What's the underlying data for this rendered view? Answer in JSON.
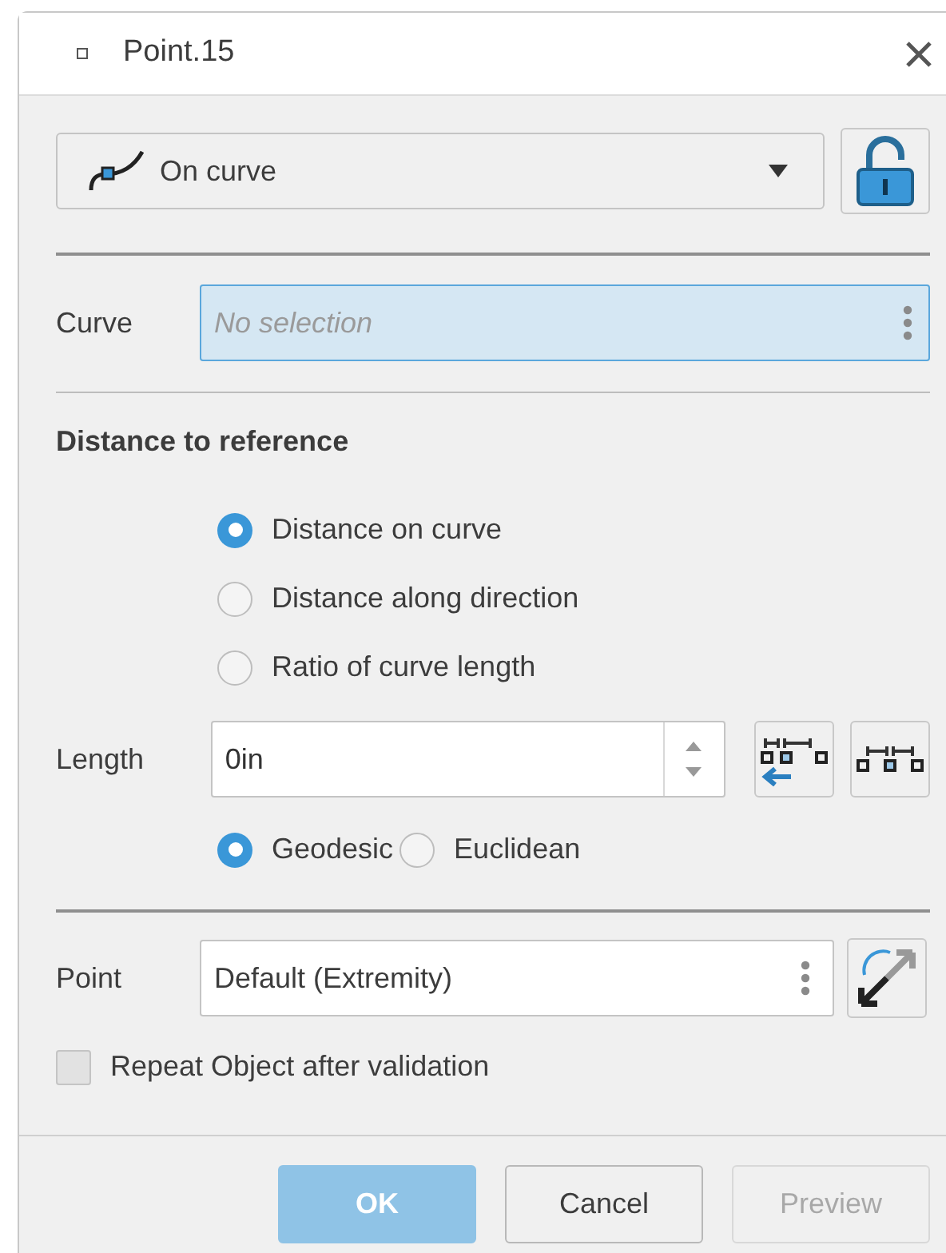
{
  "window": {
    "title": "Point.15"
  },
  "type_dropdown": {
    "value": "On curve",
    "locked": false
  },
  "curve": {
    "label": "Curve",
    "placeholder": "No selection"
  },
  "section": {
    "heading": "Distance to reference"
  },
  "distance_modes": [
    {
      "label": "Distance on curve",
      "selected": true
    },
    {
      "label": "Distance along direction",
      "selected": false
    },
    {
      "label": "Ratio of curve length",
      "selected": false
    }
  ],
  "length": {
    "label": "Length",
    "value": "0in"
  },
  "methods": [
    {
      "label": "Geodesic",
      "selected": true
    },
    {
      "label": "Euclidean",
      "selected": false
    }
  ],
  "point": {
    "label": "Point",
    "value": "Default (Extremity)"
  },
  "repeat": {
    "label": "Repeat Object after validation",
    "checked": false
  },
  "buttons": [
    {
      "label": "OK",
      "kind": "primary",
      "disabled": true
    },
    {
      "label": "Cancel",
      "kind": "normal",
      "disabled": false
    },
    {
      "label": "Preview",
      "kind": "normal",
      "disabled": true
    }
  ]
}
